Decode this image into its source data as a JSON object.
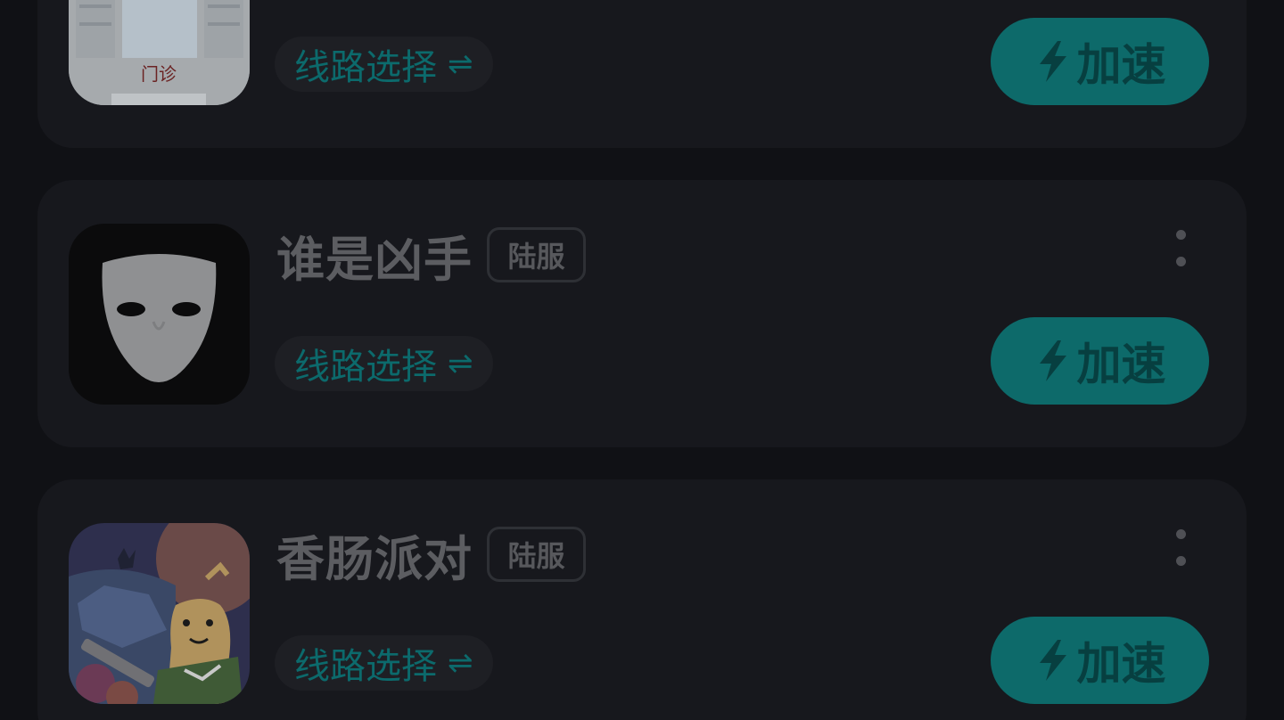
{
  "games": [
    {
      "title": "",
      "region": "",
      "route_label": "线路选择",
      "route_icon": "⇌",
      "accelerate_label": "加速",
      "icon": "hospital-game-icon",
      "icon_text": "门诊"
    },
    {
      "title": "谁是凶手",
      "region": "陆服",
      "route_label": "线路选择",
      "route_icon": "⇌",
      "accelerate_label": "加速",
      "icon": "mask-game-icon"
    },
    {
      "title": "香肠派对",
      "region": "陆服",
      "route_label": "线路选择",
      "route_icon": "⇌",
      "accelerate_label": "加速",
      "icon": "sausage-party-game-icon"
    }
  ],
  "colors": {
    "background": "#101115",
    "card": "#17181d",
    "accent": "#0d6a6a",
    "route_text": "#0c6a6c"
  }
}
